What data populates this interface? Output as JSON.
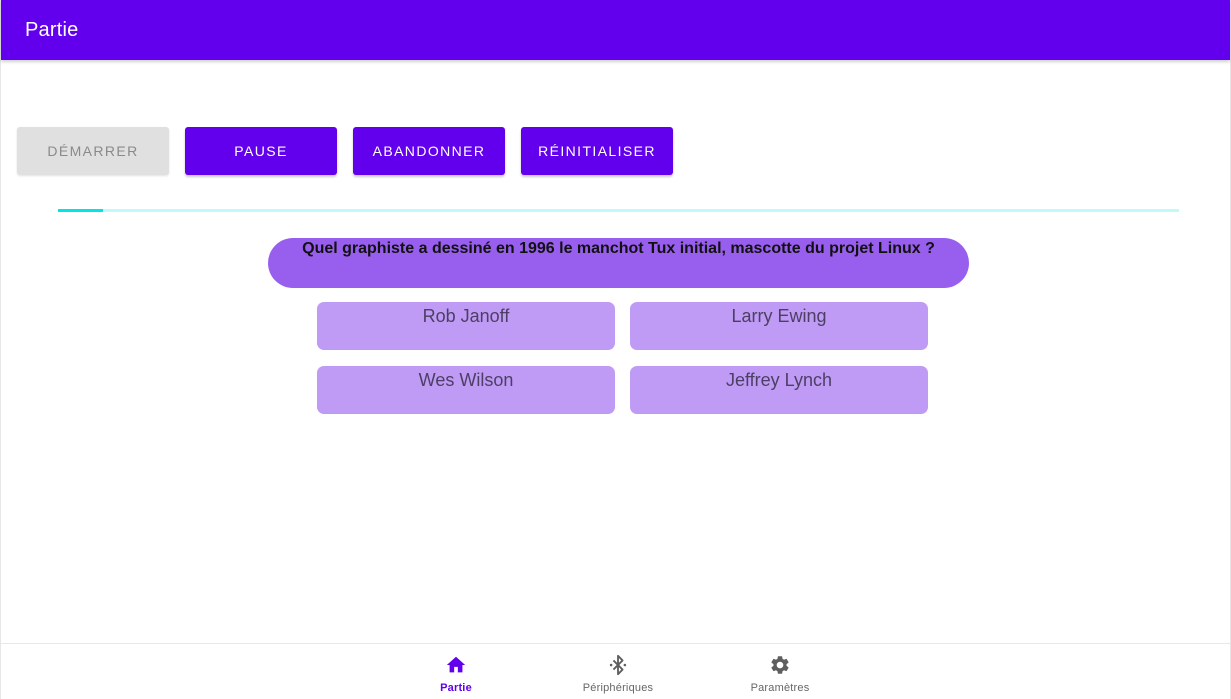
{
  "app_bar": {
    "title": "Partie"
  },
  "controls": {
    "start_label": "Démarrer",
    "pause_label": "Pause",
    "abandon_label": "Abandonner",
    "reset_label": "Réinitialiser"
  },
  "timer": {
    "progress_fraction": 0.04,
    "color": "#00e5e5",
    "track_color": "#bdfafa"
  },
  "question": {
    "text": "Quel graphiste a dessiné en 1996 le manchot Tux initial, mascotte du projet Linux ?"
  },
  "answers": [
    {
      "label": "Rob Janoff"
    },
    {
      "label": "Larry Ewing"
    },
    {
      "label": "Wes Wilson"
    },
    {
      "label": "Jeffrey Lynch"
    }
  ],
  "bottom_nav": {
    "items": [
      {
        "label": "Partie",
        "icon": "home-icon",
        "active": true
      },
      {
        "label": "Périphériques",
        "icon": "bluetooth-icon",
        "active": false
      },
      {
        "label": "Paramètres",
        "icon": "gear-icon",
        "active": false
      }
    ]
  },
  "colors": {
    "primary": "#6200ee",
    "question_bg": "#985eee",
    "answer_bg": "#bf9bf5"
  }
}
